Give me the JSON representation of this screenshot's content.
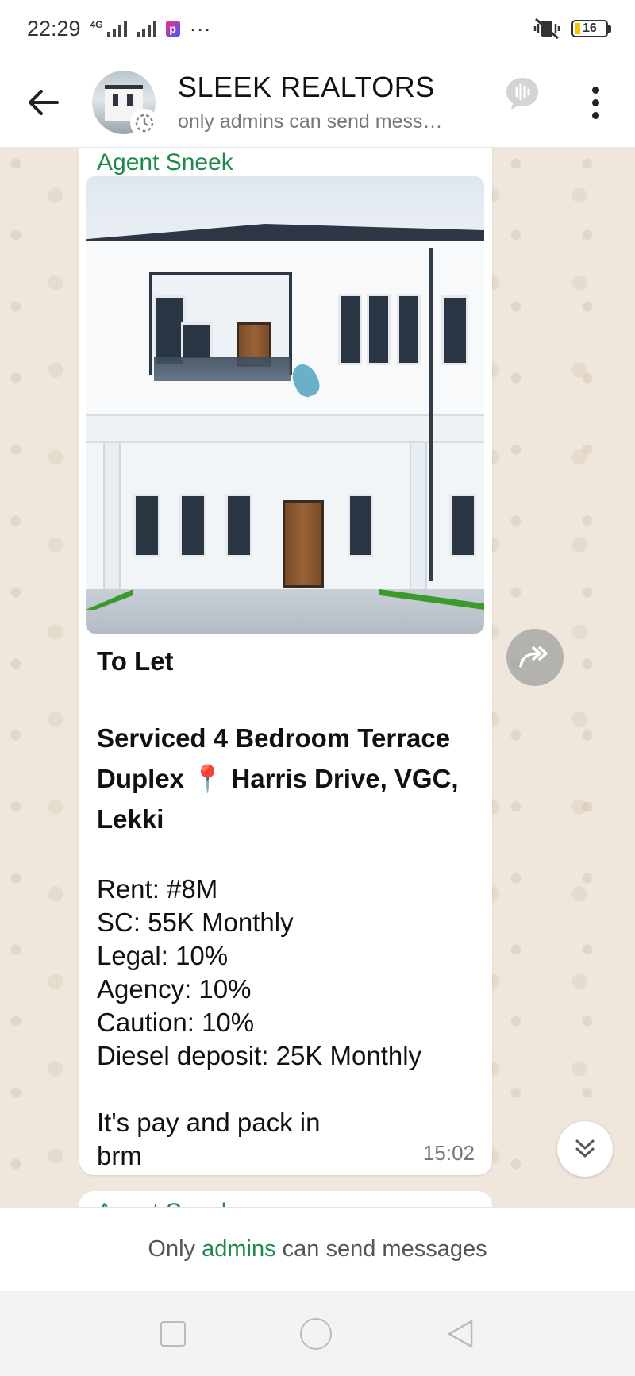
{
  "status_bar": {
    "time": "22:29",
    "network": "4G",
    "more": "···",
    "battery": "16"
  },
  "header": {
    "group_name": "SLEEK REALTORS",
    "subtitle": "only admins can send mess…"
  },
  "message": {
    "sender": "Agent Sneek",
    "title": "To Let",
    "headline_part1": "Serviced 4 Bedroom Terrace Duplex",
    "pin": "📍",
    "headline_part2": " Harris Drive, VGC, Lekki",
    "specs": [
      "Rent: #8M",
      "SC: 55K Monthly",
      "Legal: 10%",
      "Agency: 10%",
      "Caution: 10%",
      "Diesel deposit: 25K Monthly"
    ],
    "footer_line1": "It's pay and pack in",
    "footer_line2": "brm",
    "time": "15:02"
  },
  "next_message": {
    "sender": "Agent Sneek"
  },
  "footer": {
    "notice_prefix": "Only ",
    "notice_link": "admins",
    "notice_suffix": " can send messages"
  },
  "colors": {
    "sender_green": "#1a8a4a",
    "chat_background": "#efe7db",
    "bubble": "#ffffff"
  },
  "icons": [
    "back-arrow-icon",
    "avatar-status-icon",
    "voice-chat-icon",
    "more-vert-icon",
    "forward-icon",
    "scroll-down-icon",
    "nav-recents-icon",
    "nav-home-icon",
    "nav-back-icon"
  ]
}
